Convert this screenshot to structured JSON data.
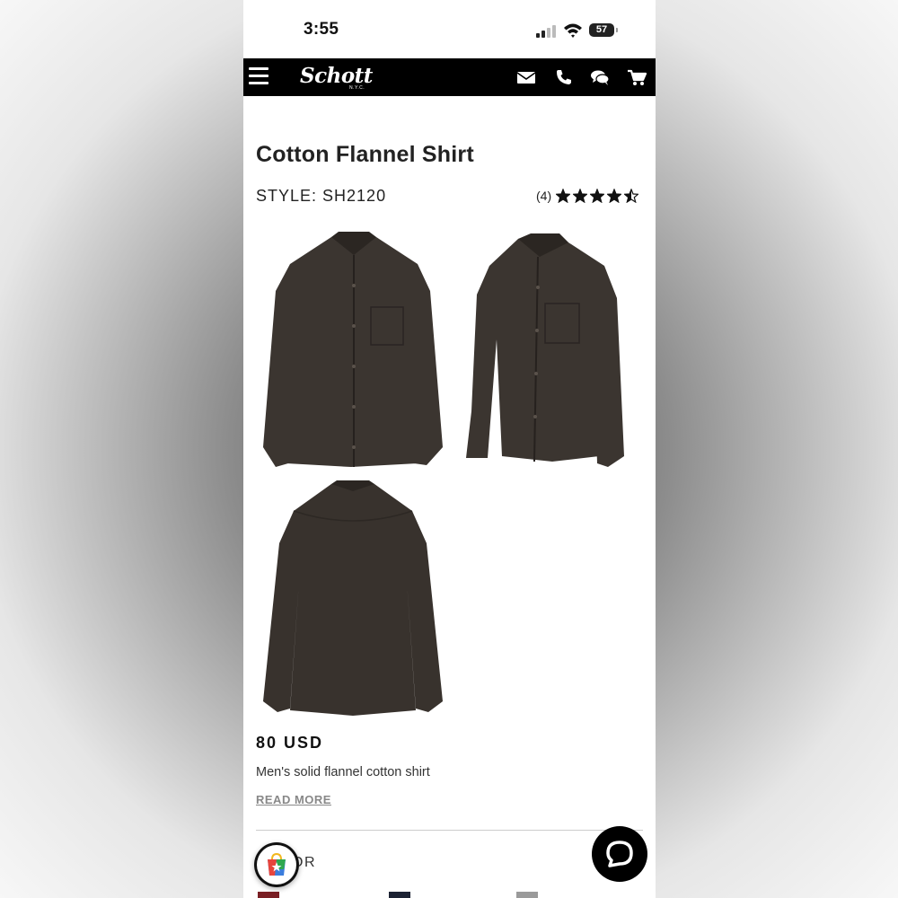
{
  "status": {
    "time": "3:55",
    "battery": "57"
  },
  "brand": {
    "logo": "Schott",
    "logo_sub": "N.Y.C."
  },
  "nav": {
    "icons": [
      "menu-icon",
      "mail-icon",
      "phone-icon",
      "chat-icon",
      "cart-icon"
    ]
  },
  "product": {
    "title": "Cotton Flannel Shirt",
    "style": "STYLE: SH2120",
    "review_count": "(4)",
    "rating": 4.5,
    "rating_max": 5,
    "price": "80 USD",
    "description": "Men's solid flannel cotton shirt",
    "read_more": "READ MORE",
    "color_label": "OR",
    "swatches": [
      "#7a1f24",
      "#1c2233",
      "#9a9a9a"
    ]
  },
  "colors": {
    "nav_bg": "#000000",
    "shirt": "#3b3530"
  }
}
